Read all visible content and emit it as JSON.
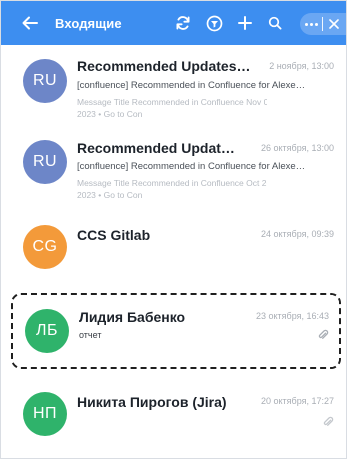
{
  "header": {
    "back_icon": "arrow-left-icon",
    "title": "Входящие",
    "actions": [
      "refresh-icon",
      "filter-icon",
      "plus-icon",
      "search-icon"
    ],
    "more_icon": "more-dots-icon",
    "close_icon": "close-icon"
  },
  "colors": {
    "header_bg": "#3d8ef0",
    "avatar_ru": "#6d86c8",
    "avatar_cg": "#f39a3a",
    "avatar_lb": "#2fb36b",
    "avatar_np": "#2fb36b"
  },
  "mails": [
    {
      "avatar": "RU",
      "sender": "Recommended Updates…",
      "date": "2 ноября, 13:00",
      "subject": "[confluence] Recommended in Confluence for Alexe…",
      "preview_line1": "Message Title Recommended in Confluence Nov 02,",
      "preview_line2": "2023 • Go to Con"
    },
    {
      "avatar": "RU",
      "sender": "Recommended Updat…",
      "date": "26 октября, 13:00",
      "subject": "[confluence] Recommended in Confluence for Alexe…",
      "preview_line1": "Message Title Recommended in Confluence Oct 26,",
      "preview_line2": "2023 • Go to Con"
    },
    {
      "avatar": "CG",
      "sender": "CCS Gitlab",
      "date": "24 октября, 09:39"
    },
    {
      "avatar": "ЛБ",
      "sender": "Лидия Бабенко",
      "date": "23 октября, 16:43",
      "subject": "отчет",
      "attachment_icon": "paperclip-icon"
    },
    {
      "avatar": "НП",
      "sender": "Никита Пирогов (Jira)",
      "date": "20 октября, 17:27"
    }
  ]
}
